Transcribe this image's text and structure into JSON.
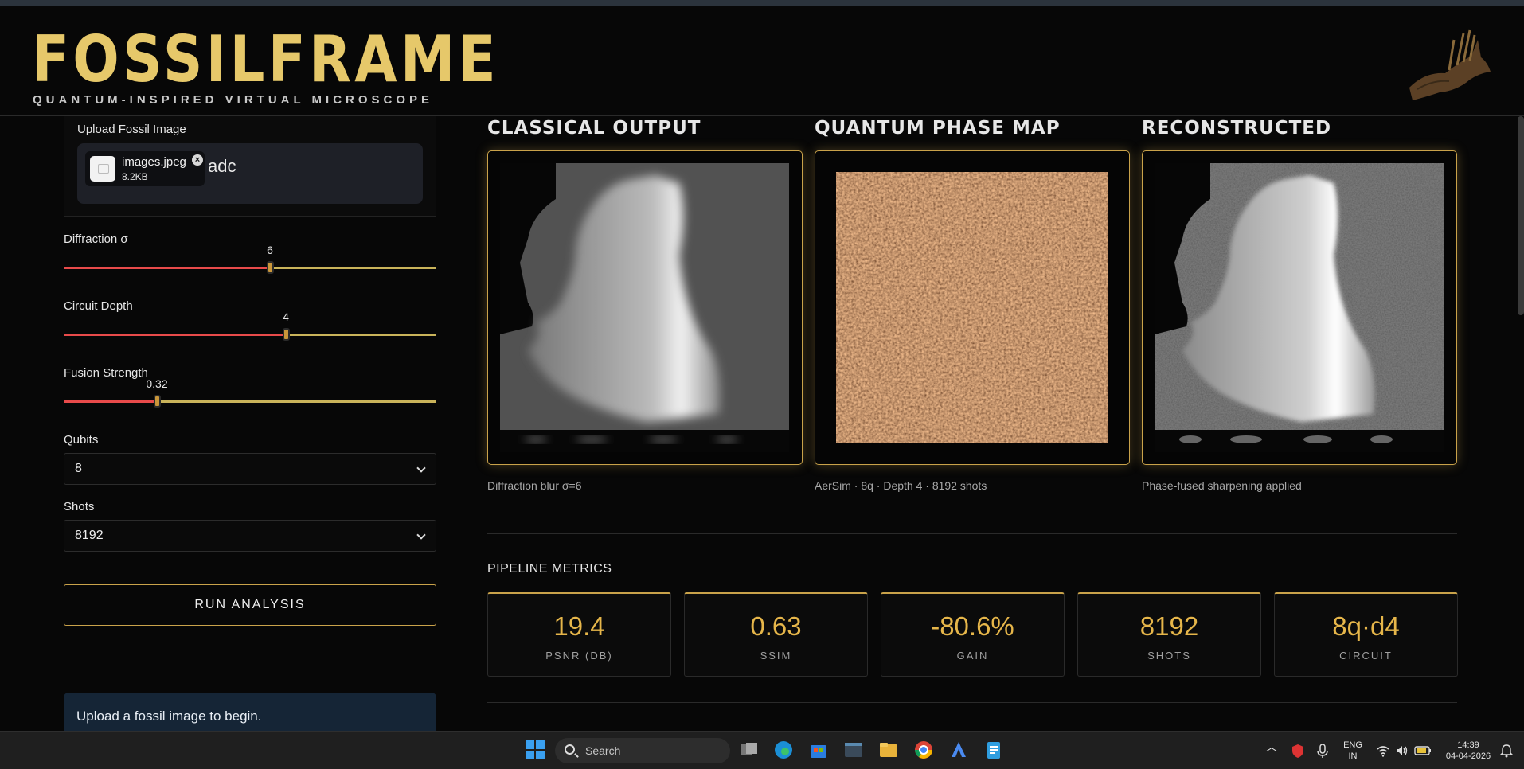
{
  "header": {
    "title": "FOSSILFRAME",
    "subtitle": "QUANTUM-INSPIRED VIRTUAL MICROSCOPE"
  },
  "sidebar": {
    "upload": {
      "label": "Upload Fossil Image",
      "file_name": "images.jpeg",
      "file_size": "8.2KB",
      "trailing_text": "adc"
    },
    "diffraction": {
      "label": "Diffraction σ",
      "value": "6",
      "fraction": 0.553
    },
    "circuit_depth": {
      "label": "Circuit Depth",
      "value": "4",
      "fraction": 0.597
    },
    "fusion_strength": {
      "label": "Fusion Strength",
      "value": "0.32",
      "fraction": 0.25
    },
    "qubits": {
      "label": "Qubits",
      "value": "8"
    },
    "shots": {
      "label": "Shots",
      "value": "8192"
    },
    "run_button": "RUN ANALYSIS",
    "info_message": "Upload a fossil image to begin."
  },
  "panels": [
    {
      "title": "CLASSICAL OUTPUT",
      "caption": "Diffraction blur σ=6"
    },
    {
      "title": "QUANTUM PHASE MAP",
      "caption": "AerSim · 8q · Depth 4 · 8192 shots"
    },
    {
      "title": "RECONSTRUCTED",
      "caption": "Phase-fused sharpening applied"
    }
  ],
  "metrics": {
    "title": "PIPELINE METRICS",
    "items": [
      {
        "value": "19.4",
        "label": "PSNR (DB)"
      },
      {
        "value": "0.63",
        "label": "SSIM"
      },
      {
        "value": "-80.6%",
        "label": "GAIN"
      },
      {
        "value": "8192",
        "label": "SHOTS"
      },
      {
        "value": "8q·d4",
        "label": "CIRCUIT"
      }
    ]
  },
  "taskbar": {
    "search_placeholder": "Search",
    "lang_top": "ENG",
    "lang_bottom": "IN",
    "time": "14:39",
    "date": "04-04-2026"
  },
  "colors": {
    "accent_gold": "#e6c86a",
    "metric_value": "#e6b64a",
    "slider_fill": "#e84a4a",
    "slider_rest": "#c9b35a"
  }
}
